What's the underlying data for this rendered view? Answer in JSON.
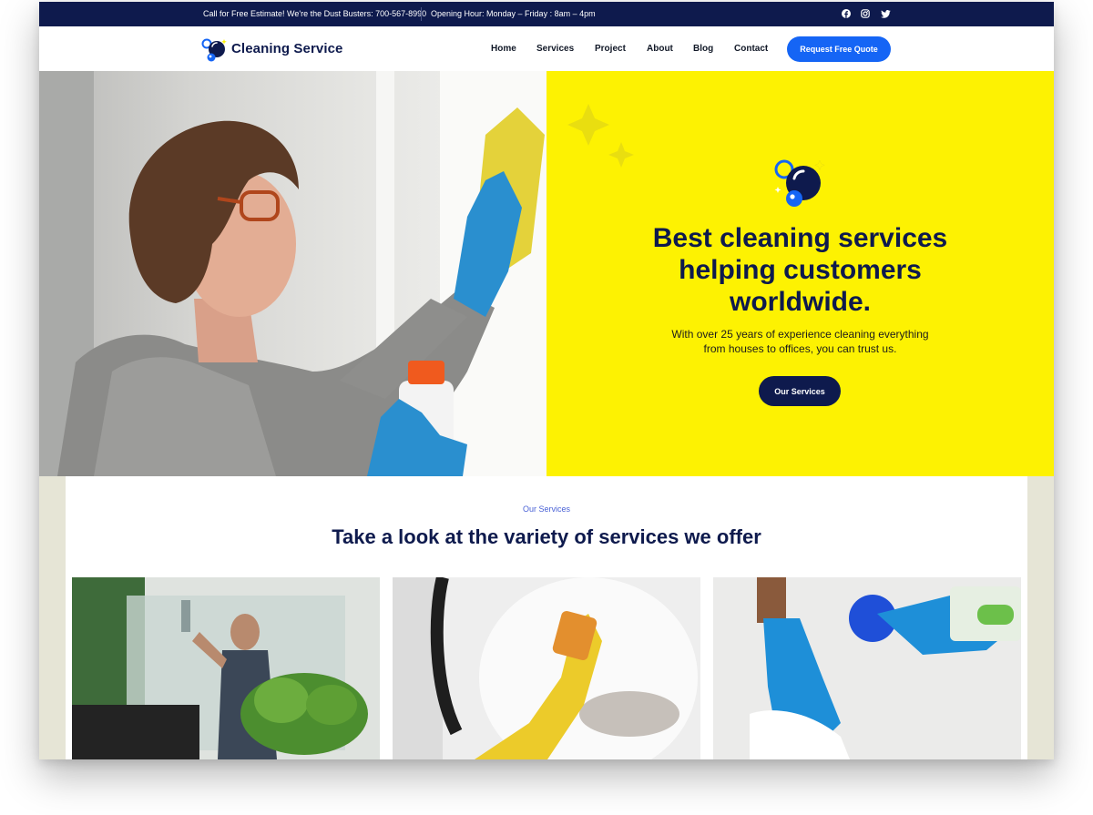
{
  "topbar": {
    "phone_text": "Call for Free Estimate! We're the Dust Busters: 700-567-8990",
    "hours_text": "Opening Hour: Monday – Friday : 8am – 4pm",
    "social_icons": [
      "facebook-icon",
      "instagram-icon",
      "twitter-icon"
    ]
  },
  "brand": {
    "name": "Cleaning Service"
  },
  "nav": {
    "items": [
      "Home",
      "Services",
      "Project",
      "About",
      "Blog",
      "Contact"
    ],
    "cta_label": "Request Free Quote"
  },
  "hero": {
    "title": "Best cleaning services helping customers worldwide.",
    "subtitle_lines": [
      "With over 25 years of experience cleaning everything",
      "from houses to offices, you can trust us."
    ],
    "button_label": "Our Services"
  },
  "services": {
    "label": "Our Services",
    "title": "Take a look at the variety of services we offer"
  },
  "colors": {
    "navy": "#0e1a4d",
    "blue": "#1565f5",
    "yellow": "#fdf202",
    "accent_text": "#4a62d6",
    "section_bg": "#e6e5d6"
  }
}
